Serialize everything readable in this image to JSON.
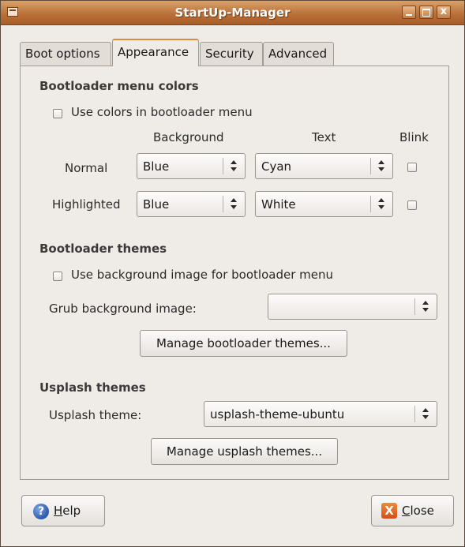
{
  "window": {
    "title": "StartUp-Manager",
    "close_glyph": "x"
  },
  "tabs": [
    {
      "label": "Boot options",
      "active": false
    },
    {
      "label": "Appearance",
      "active": true
    },
    {
      "label": "Security",
      "active": false
    },
    {
      "label": "Advanced",
      "active": false
    }
  ],
  "menu_colors": {
    "title": "Bootloader menu colors",
    "use_colors_label": "Use colors in bootloader menu",
    "use_colors_checked": false,
    "col_background": "Background",
    "col_text": "Text",
    "col_blink": "Blink",
    "rows": [
      {
        "label": "Normal",
        "background": "Blue",
        "text": "Cyan",
        "blink": false
      },
      {
        "label": "Highlighted",
        "background": "Blue",
        "text": "White",
        "blink": false
      }
    ]
  },
  "bootloader_themes": {
    "title": "Bootloader themes",
    "use_bg_label": "Use background image for bootloader menu",
    "use_bg_checked": false,
    "grub_bg_label": "Grub background image:",
    "grub_bg_value": "",
    "manage_button": "Manage bootloader themes..."
  },
  "usplash": {
    "title": "Usplash themes",
    "theme_label": "Usplash theme:",
    "theme_value": "usplash-theme-ubuntu",
    "manage_button": "Manage usplash themes..."
  },
  "footer": {
    "help_mnemonic": "H",
    "help_rest": "elp",
    "help_icon_glyph": "?",
    "close_mnemonic": "C",
    "close_rest": "lose",
    "close_icon_glyph": "X"
  },
  "colors": {
    "titlebar": "#b86e36",
    "active_tab_accent": "#e08a35",
    "window_bg": "#efebe7"
  }
}
